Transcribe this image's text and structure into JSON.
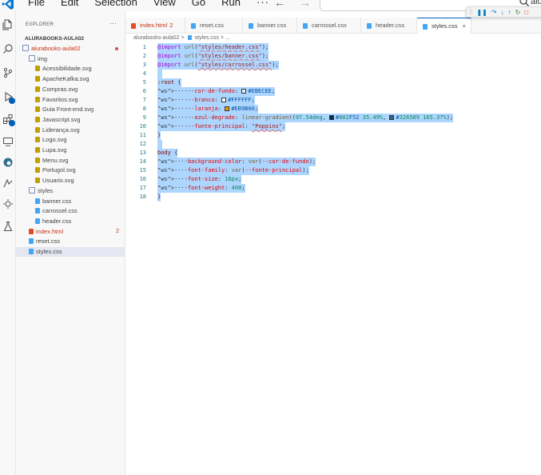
{
  "menu": {
    "items": [
      "File",
      "Edit",
      "Selection",
      "View",
      "Go",
      "Run",
      "···"
    ],
    "back_arrow": "←",
    "forward_arrow": "→"
  },
  "search": {
    "text": "alura"
  },
  "sidebar": {
    "title": "EXPLORER",
    "more": "···",
    "project_root": "ALURABOOKS-AULA02",
    "tree": [
      {
        "label": "alurabooks-aula02",
        "type": "folder",
        "indent": 0,
        "red": true,
        "dot": true
      },
      {
        "label": "img",
        "type": "folder",
        "indent": 1
      },
      {
        "label": "Acessibilidade.svg",
        "type": "svg",
        "indent": 2
      },
      {
        "label": "ApacheKafka.svg",
        "type": "svg",
        "indent": 2
      },
      {
        "label": "Compras.svg",
        "type": "svg",
        "indent": 2
      },
      {
        "label": "Favoritos.svg",
        "type": "svg",
        "indent": 2
      },
      {
        "label": "Guia Front-end.svg",
        "type": "svg",
        "indent": 2
      },
      {
        "label": "Javascript.svg",
        "type": "svg",
        "indent": 2
      },
      {
        "label": "Liderança.svg",
        "type": "svg",
        "indent": 2
      },
      {
        "label": "Logo.svg",
        "type": "svg",
        "indent": 2
      },
      {
        "label": "Lupa.svg",
        "type": "svg",
        "indent": 2
      },
      {
        "label": "Menu.svg",
        "type": "svg",
        "indent": 2
      },
      {
        "label": "Portugol.svg",
        "type": "svg",
        "indent": 2
      },
      {
        "label": "Usuario.svg",
        "type": "svg",
        "indent": 2
      },
      {
        "label": "styles",
        "type": "folder",
        "indent": 1
      },
      {
        "label": "banner.css",
        "type": "css",
        "indent": 2
      },
      {
        "label": "carrossel.css",
        "type": "css",
        "indent": 2
      },
      {
        "label": "header.css",
        "type": "css",
        "indent": 2
      },
      {
        "label": "index.html",
        "type": "html",
        "indent": 1,
        "red": true,
        "count": "2"
      },
      {
        "label": "reset.css",
        "type": "css",
        "indent": 1
      },
      {
        "label": "styles.css",
        "type": "css",
        "indent": 1,
        "selected": true
      }
    ]
  },
  "tabs": [
    {
      "label": "index.html",
      "type": "html",
      "count": "2",
      "red": true
    },
    {
      "label": "reset.css",
      "type": "css"
    },
    {
      "label": "banner.css",
      "type": "css"
    },
    {
      "label": "carrossel.css",
      "type": "css"
    },
    {
      "label": "header.css",
      "type": "css"
    },
    {
      "label": "styles.css",
      "type": "css",
      "active": true,
      "close": "×"
    }
  ],
  "breadcrumb": {
    "root": "alurabooks-aula02",
    "sep": ">",
    "file": "styles.css",
    "tail": "..."
  },
  "editor": {
    "lines": [
      {
        "n": "1",
        "code": "@import url(\"styles/header.css\");"
      },
      {
        "n": "2",
        "code": "@import url(\"styles/banner.css\");"
      },
      {
        "n": "3",
        "code": "@import url(\"styles/carrossel.css\");"
      },
      {
        "n": "4",
        "code": ""
      },
      {
        "n": "5",
        "code": ":root {"
      },
      {
        "n": "6",
        "code": "    --cor-de-fundo: #EBECEE;"
      },
      {
        "n": "7",
        "code": "    --branco: #FFFFFF;"
      },
      {
        "n": "8",
        "code": "    --laranja: #EB9B00;"
      },
      {
        "n": "9",
        "code": "    --azul-degrade: linear-gradient(97.54deg, #002F52 35.49%, #326589 165.37%);"
      },
      {
        "n": "10",
        "code": "    --fonte-principal: \"Poppins\";"
      },
      {
        "n": "11",
        "code": "}"
      },
      {
        "n": "12",
        "code": ""
      },
      {
        "n": "13",
        "code": "body {"
      },
      {
        "n": "14",
        "code": "    background-color: var(--cor-de-fundo);"
      },
      {
        "n": "15",
        "code": "    font-family: var(--fonte-principal);"
      },
      {
        "n": "16",
        "code": "    font-size: 16px;"
      },
      {
        "n": "17",
        "code": "    font-weight: 400;"
      },
      {
        "n": "18",
        "code": "}"
      }
    ]
  },
  "colors": {
    "accent": "#005fb8",
    "selection": "#add6ff",
    "error": "#c72e0f",
    "swatch_cor_de_fundo": "#EBECEE",
    "swatch_branco": "#FFFFFF",
    "swatch_laranja": "#EB9B00",
    "swatch_azul1": "#002F52",
    "swatch_azul2": "#326589"
  }
}
